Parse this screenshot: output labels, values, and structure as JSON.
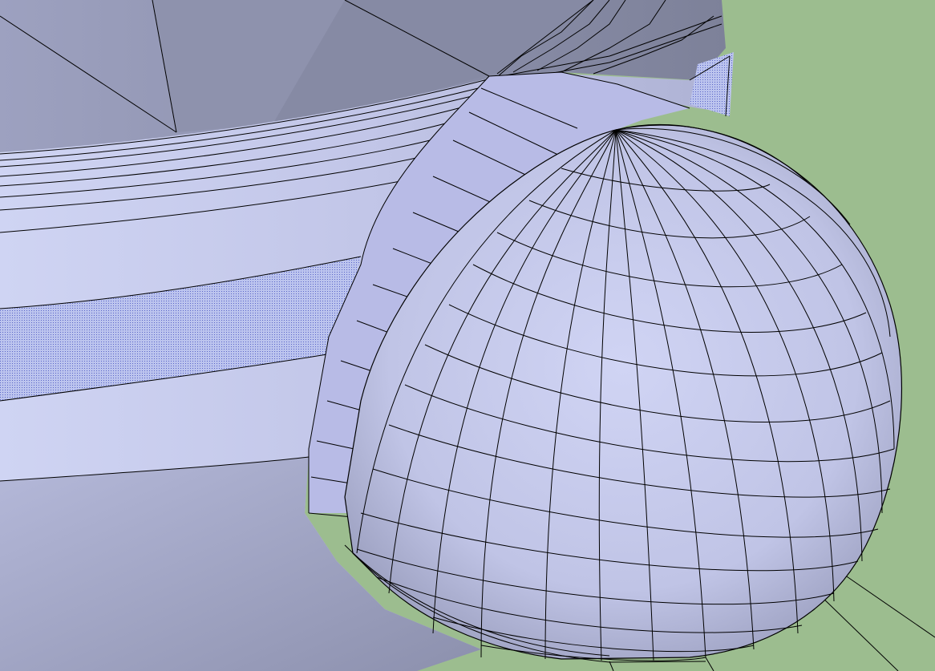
{
  "viewport": {
    "ground_color": "#9cbd8f",
    "face_color": "#c8ccf0",
    "shadow_face_color": "#8f93b0",
    "edge_color": "#000000"
  },
  "scene": {
    "objects": [
      {
        "name": "bowl",
        "icon": "bowl-mesh-icon"
      },
      {
        "name": "handle",
        "icon": "sphere-handle-icon"
      }
    ]
  }
}
